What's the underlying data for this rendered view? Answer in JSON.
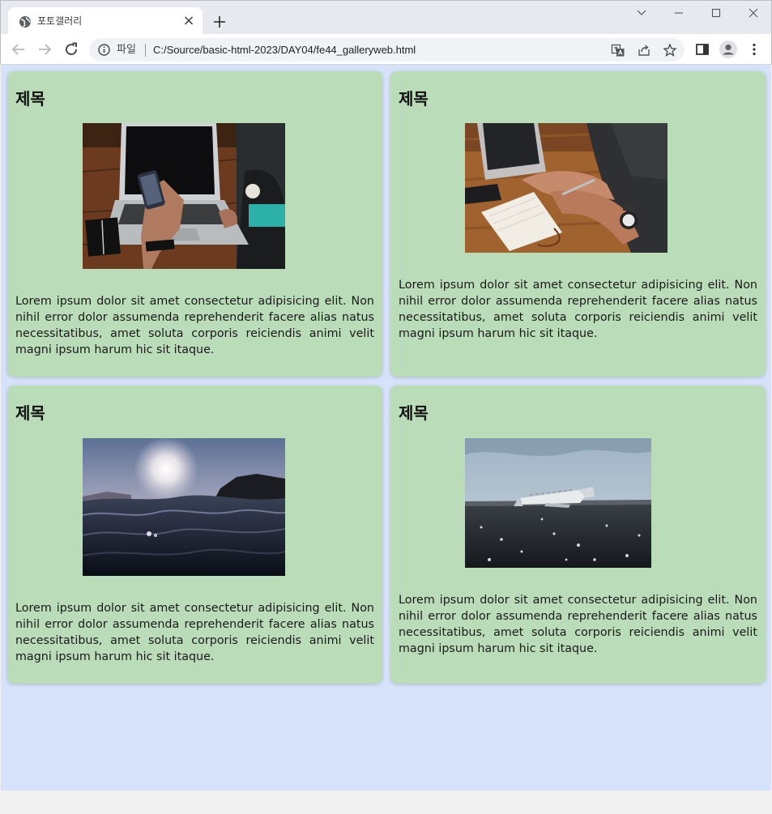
{
  "browser": {
    "tab_title": "포토갤러리",
    "scheme_label": "파일",
    "url": "C:/Source/basic-html-2023/DAY04/fe44_galleryweb.html",
    "tab_close_glyph": "×"
  },
  "page": {
    "background": "#d6e2f9",
    "card_background": "#badcb8",
    "cards": [
      {
        "heading": "제목",
        "photo": "laptop-and-smartphone-photo",
        "text": "Lorem ipsum dolor sit amet consectetur adipisicing elit. Non nihil error dolor assumenda reprehenderit facere alias natus necessitatibus, amet soluta corporis reiciendis animi velit magni ipsum harum hic sit itaque."
      },
      {
        "heading": "제목",
        "photo": "hands-writing-notebook-photo",
        "text": "Lorem ipsum dolor sit amet consectetur adipisicing elit. Non nihil error dolor assumenda reprehenderit facere alias natus necessitatibus, amet soluta corporis reiciendis animi velit magni ipsum harum hic sit itaque."
      },
      {
        "heading": "제목",
        "photo": "ocean-waves-sunset-photo",
        "text": "Lorem ipsum dolor sit amet consectetur adipisicing elit. Non nihil error dolor assumenda reprehenderit facere alias natus necessitatibus, amet soluta corporis reiciendis animi velit magni ipsum harum hic sit itaque."
      },
      {
        "heading": "제목",
        "photo": "plane-wreck-beach-photo",
        "text": "Lorem ipsum dolor sit amet consectetur adipisicing elit. Non nihil error dolor assumenda reprehenderit facere alias natus necessitatibus, amet soluta corporis reiciendis animi velit magni ipsum harum hic sit itaque."
      }
    ]
  }
}
